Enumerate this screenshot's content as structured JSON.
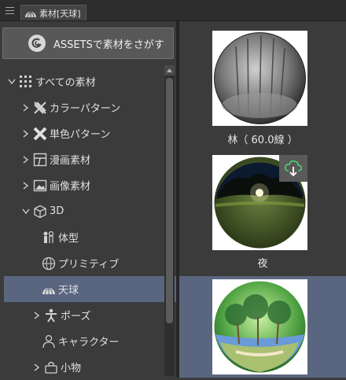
{
  "tab": {
    "title": "素材[天球]"
  },
  "assets_button": {
    "label": "ASSETSで素材をさがす"
  },
  "tree": {
    "items": [
      {
        "label": "すべての素材"
      },
      {
        "label": "カラーパターン"
      },
      {
        "label": "単色パターン"
      },
      {
        "label": "漫画素材"
      },
      {
        "label": "画像素材"
      },
      {
        "label": "3D"
      },
      {
        "label": "体型"
      },
      {
        "label": "プリミティブ"
      },
      {
        "label": "天球"
      },
      {
        "label": "ポーズ"
      },
      {
        "label": "キャラクター"
      },
      {
        "label": "小物"
      }
    ]
  },
  "materials": [
    {
      "caption": "林（ 60.0線 ）"
    },
    {
      "caption": "夜"
    },
    {
      "caption": ""
    }
  ],
  "colors": {
    "selection": "#5a6680",
    "background": "#3b3b3b"
  }
}
